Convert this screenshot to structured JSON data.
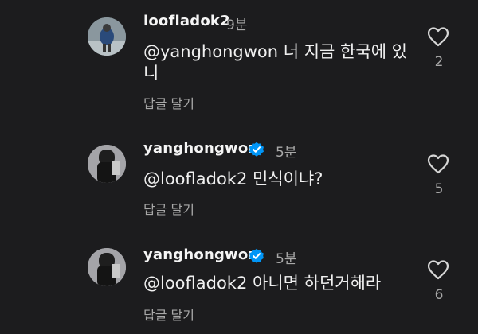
{
  "comments": [
    {
      "username": "loofladok2",
      "verified": false,
      "time": "9분",
      "text": "@yanghongwon 너 지금 한국에 있니",
      "reply_label": "답글 달기",
      "likes": "2",
      "avatar_icon": "avatar-icon"
    },
    {
      "username": "yanghongwon",
      "verified": true,
      "time": "5분",
      "text": "@loofladok2 민식이냐?",
      "reply_label": "답글 달기",
      "likes": "5",
      "avatar_icon": "avatar-icon"
    },
    {
      "username": "yanghongwon",
      "verified": true,
      "time": "5분",
      "text": "@loofladok2 아니면 하던거해라",
      "reply_label": "답글 달기",
      "likes": "6",
      "avatar_icon": "avatar-icon"
    }
  ],
  "colors": {
    "background": "#1c1c1e",
    "text": "#f0f0f0",
    "muted": "#a8a8a8",
    "verified": "#0095f6"
  }
}
